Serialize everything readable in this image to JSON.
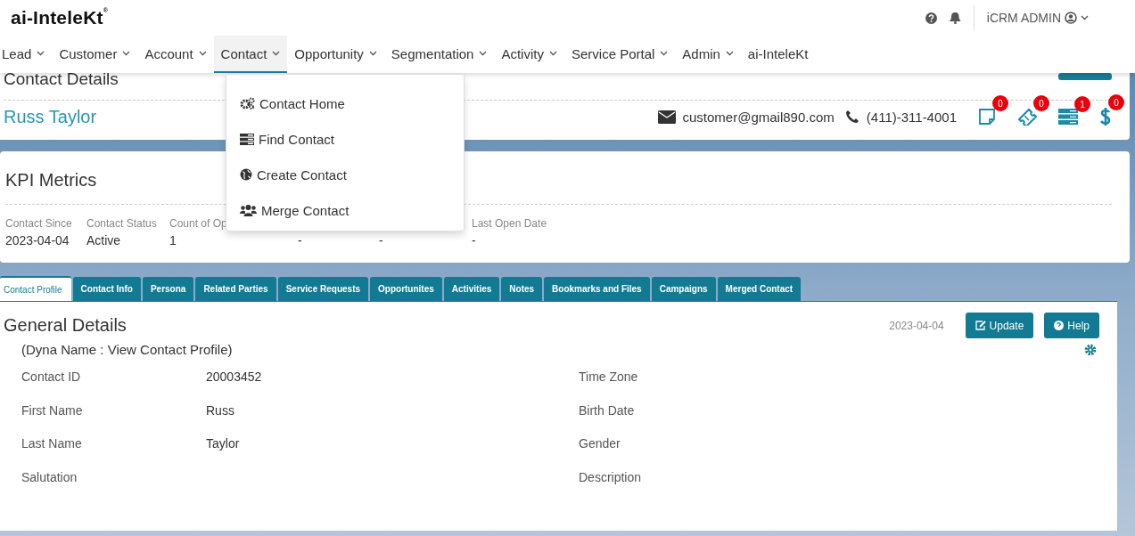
{
  "logo": {
    "prefix": "ai-",
    "name": "InteleKt",
    "mark": "®"
  },
  "header": {
    "user": "iCRM ADMIN"
  },
  "nav": [
    {
      "label": "Lead",
      "selected": false,
      "caret": true
    },
    {
      "label": "Customer",
      "selected": false,
      "caret": true
    },
    {
      "label": "Account",
      "selected": false,
      "caret": true
    },
    {
      "label": "Contact",
      "selected": true,
      "caret": true
    },
    {
      "label": "Opportunity",
      "selected": false,
      "caret": true
    },
    {
      "label": "Segmentation",
      "selected": false,
      "caret": true
    },
    {
      "label": "Activity",
      "selected": false,
      "caret": true
    },
    {
      "label": "Service Portal",
      "selected": false,
      "caret": true
    },
    {
      "label": "Admin",
      "selected": false,
      "caret": true
    },
    {
      "label": "ai-InteleKt",
      "selected": false,
      "caret": false
    }
  ],
  "menu": [
    {
      "label": "Contact Home",
      "kind": "gears"
    },
    {
      "label": "Find Contact",
      "kind": "list"
    },
    {
      "label": "Create Contact",
      "kind": "globe"
    },
    {
      "label": "Merge Contact",
      "kind": "users"
    }
  ],
  "contact": {
    "title": "Contact Details",
    "name": "Russ Taylor",
    "email": "customer@gmail890.com",
    "phone": "(411)-311-4001",
    "counters": [
      {
        "kind": "note",
        "count": "0"
      },
      {
        "kind": "ticket",
        "count": "0"
      },
      {
        "kind": "server",
        "count": "1"
      },
      {
        "kind": "dollar",
        "count": "0"
      }
    ]
  },
  "kpi": {
    "title": "KPI Metrics",
    "items": [
      {
        "label": "Contact Since",
        "value": "2023-04-04"
      },
      {
        "label": "Contact Status",
        "value": "Active"
      },
      {
        "label": "Count of Op",
        "value": "1"
      },
      {
        "value": "-"
      },
      {
        "value": "-"
      },
      {
        "label": "Last Open Date",
        "value": "-"
      }
    ]
  },
  "tabs": [
    {
      "label": "Contact Profile",
      "selected": true
    },
    {
      "label": "Contact Info",
      "selected": false
    },
    {
      "label": "Persona",
      "selected": false
    },
    {
      "label": "Related Parties",
      "selected": false
    },
    {
      "label": "Service Requests",
      "selected": false
    },
    {
      "label": "Opportunites",
      "selected": false
    },
    {
      "label": "Activities",
      "selected": false
    },
    {
      "label": "Notes",
      "selected": false
    },
    {
      "label": "Bookmarks and Files",
      "selected": false
    },
    {
      "label": "Campaigns",
      "selected": false
    },
    {
      "label": "Merged Contact",
      "selected": false
    }
  ],
  "details": {
    "title": "General Details",
    "date": "2023-04-04",
    "buttons": [
      {
        "label": "Update",
        "kind": "edit"
      },
      {
        "label": "Help",
        "kind": "help"
      }
    ],
    "subtitle": "(Dyna Name : View Contact Profile)",
    "fields": [
      {
        "label": "Contact ID",
        "value": "20003452"
      },
      {
        "label": "Time Zone"
      },
      {
        "label": "First Name",
        "value": "Russ"
      },
      {
        "label": "Birth Date"
      },
      {
        "label": "Last Name",
        "value": "Taylor"
      },
      {
        "label": "Gender"
      },
      {
        "label": "Salutation"
      },
      {
        "label": "Description"
      }
    ]
  }
}
